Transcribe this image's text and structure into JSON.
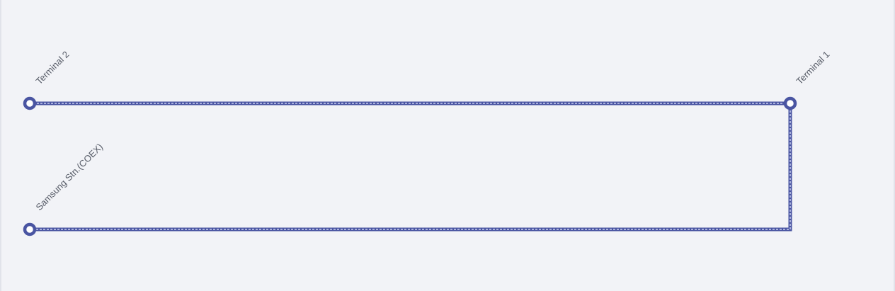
{
  "map": {
    "line_color": "#4a55a2",
    "line_dash_color": "#a9b0dc",
    "background": "#f2f3f7",
    "stations": [
      {
        "id": "terminal-2",
        "name": "Terminal 2"
      },
      {
        "id": "terminal-1",
        "name": "Terminal 1"
      },
      {
        "id": "samsung-stn-coex",
        "name": "Samsung Stn.(COEX)"
      }
    ]
  }
}
